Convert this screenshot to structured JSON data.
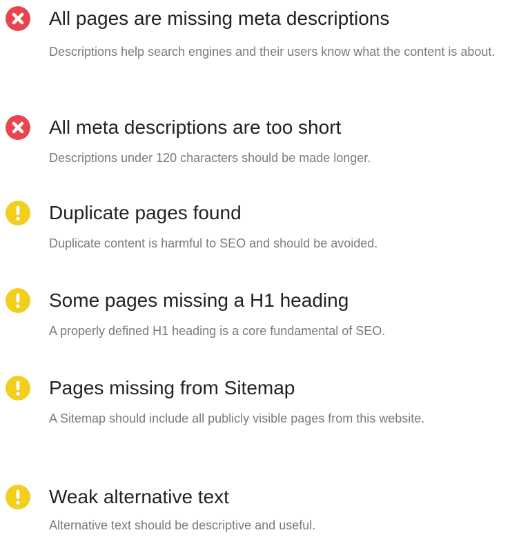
{
  "colors": {
    "error": "#e9454e",
    "warning": "#f2cf1d",
    "title_text": "#222222",
    "description_text": "#7a7a7a"
  },
  "issues": [
    {
      "severity": "error",
      "icon": "error-x-icon",
      "title": "All pages are missing meta descriptions",
      "description": "Descriptions help search engines and their users know what the content is about."
    },
    {
      "severity": "error",
      "icon": "error-x-icon",
      "title": "All meta descriptions are too short",
      "description": "Descriptions under 120 characters should be made longer."
    },
    {
      "severity": "warning",
      "icon": "warning-exclamation-icon",
      "title": "Duplicate pages found",
      "description": "Duplicate content is harmful to SEO and should be avoided."
    },
    {
      "severity": "warning",
      "icon": "warning-exclamation-icon",
      "title": "Some pages missing a H1 heading",
      "description": "A properly defined H1 heading is a core fundamental of SEO."
    },
    {
      "severity": "warning",
      "icon": "warning-exclamation-icon",
      "title": "Pages missing from Sitemap",
      "description": "A Sitemap should include all publicly visible pages from this website."
    },
    {
      "severity": "warning",
      "icon": "warning-exclamation-icon",
      "title": "Weak alternative text",
      "description": "Alternative text should be descriptive and useful."
    }
  ]
}
